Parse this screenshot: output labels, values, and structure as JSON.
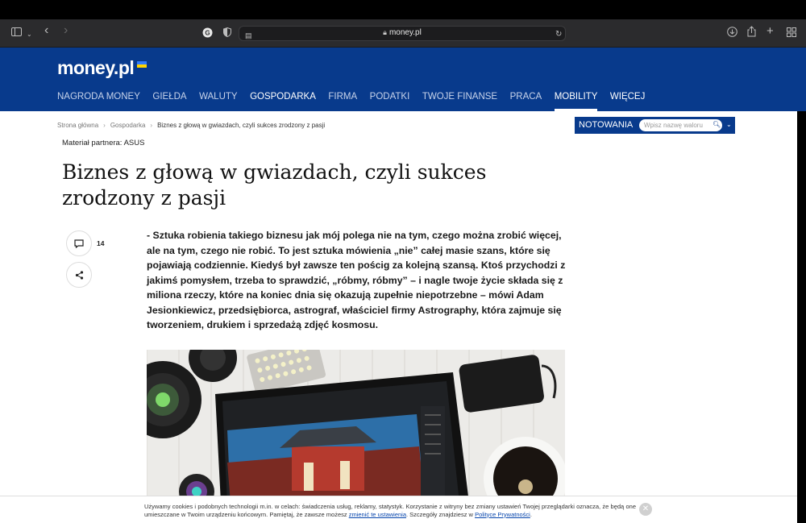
{
  "browser": {
    "url": "money.pl",
    "sidebar_icon": "sidebar-icon",
    "back_icon": "‹",
    "forward_icon": "›"
  },
  "header": {
    "logo": "money.pl",
    "nav": [
      {
        "label": "NAGRODA MONEY"
      },
      {
        "label": "GIEŁDA"
      },
      {
        "label": "WALUTY"
      },
      {
        "label": "GOSPODARKA"
      },
      {
        "label": "FIRMA"
      },
      {
        "label": "PODATKI"
      },
      {
        "label": "TWOJE FINANSE"
      },
      {
        "label": "PRACA"
      },
      {
        "label": "MOBILITY"
      },
      {
        "label": "WIĘCEJ"
      }
    ]
  },
  "breadcrumb": {
    "home": "Strona główna",
    "section": "Gospodarka",
    "current": "Biznes z głową w gwiazdach, czyli sukces zrodzony z pasji"
  },
  "quotes": {
    "label": "NOTOWANIA",
    "placeholder": "Wpisz nazwę waloru"
  },
  "article": {
    "partner": "Materiał partnera: ASUS",
    "title": "Biznes z głową w gwiazdach, czyli sukces zrodzony z pasji",
    "comments_count": "14",
    "lead": "- Sztuka robienia takiego biznesu jak mój polega nie na tym, czego można zrobić więcej, ale na tym, czego nie robić. To jest sztuka mówienia „nie” całej masie szans, które się pojawiają codziennie. Kiedyś był zawsze ten pościg za kolejną szansą. Ktoś przychodzi z jakimś pomysłem, trzeba to sprawdzić, „róbmy, róbmy” – i nagle twoje życie składa się z miliona rzeczy, które na koniec dnia się okazują zupełnie niepotrzebne – mówi Adam Jesionkiewicz, przedsiębiorca, astrograf, właściciel firmy Astrography, która zajmuje się tworzeniem, drukiem i sprzedażą zdjęć kosmosu."
  },
  "cookie": {
    "text_before": "Używamy cookies i podobnych technologii m.in. w celach: świadczenia usług, reklamy, statystyk. Korzystanie z witryny bez zmiany ustawień Twojej przeglądarki oznacza, że będą one umieszczane w Twoim urządzeniu końcowym. Pamiętaj, że zawsze możesz ",
    "link1": "zmienić te ustawienia",
    "text_middle": ". Szczegóły znajdziesz w ",
    "link2": "Polityce Prywatności",
    "text_after": "."
  }
}
